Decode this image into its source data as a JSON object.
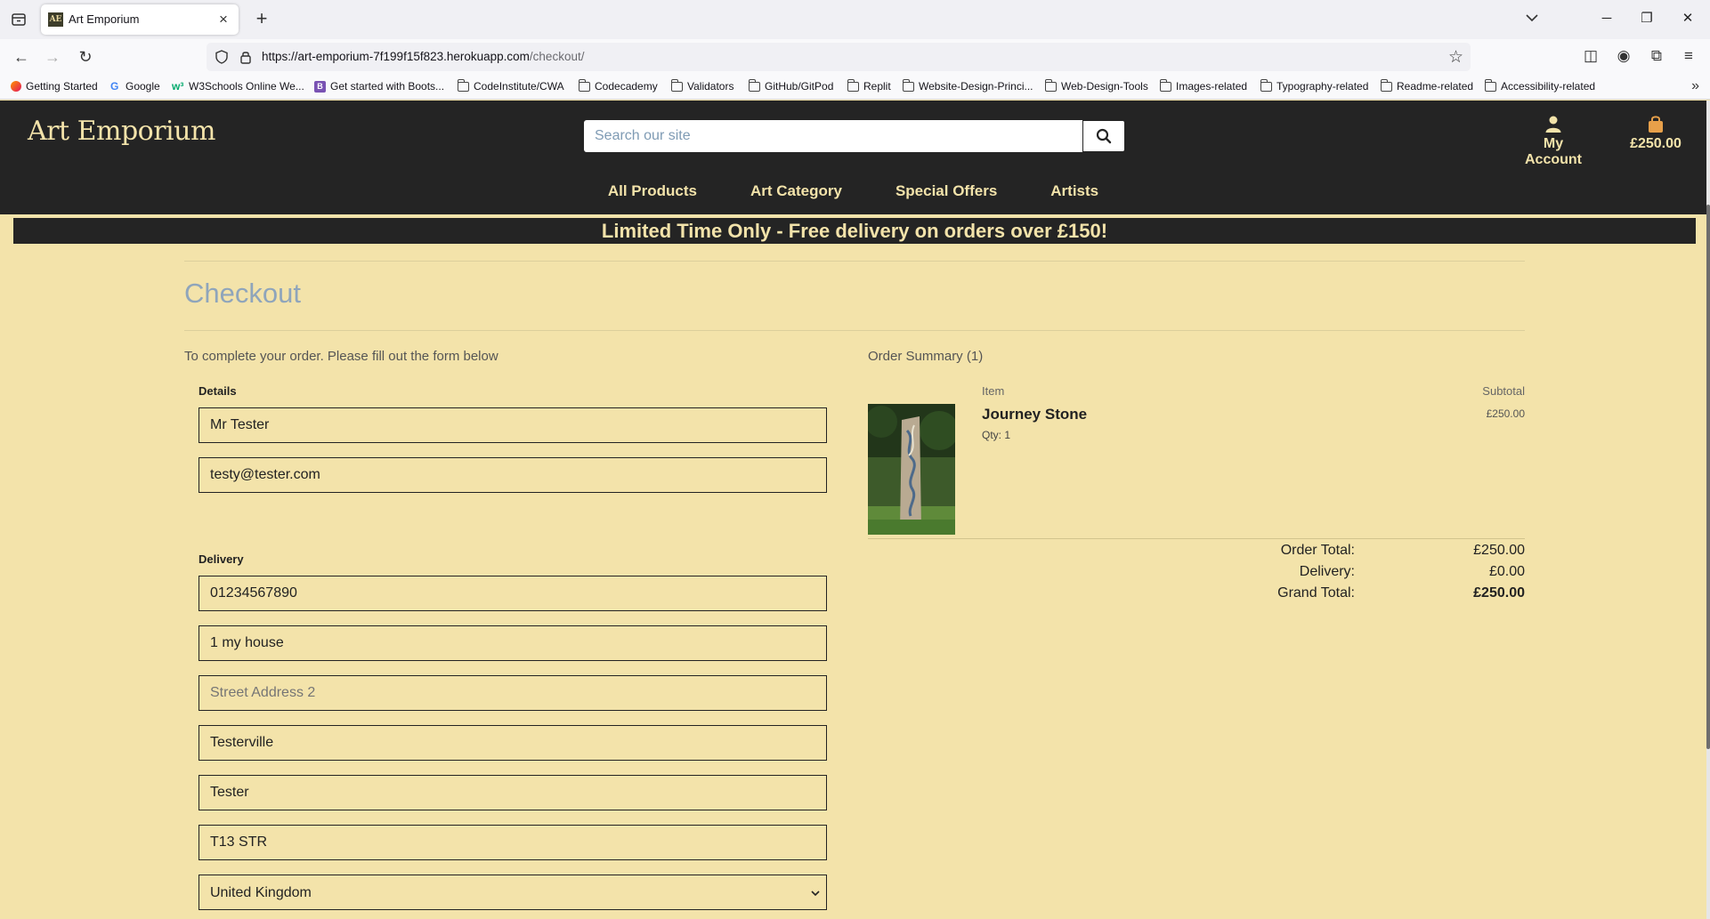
{
  "browser": {
    "tab_title": "Art Emporium",
    "tab_favicon_text": "AE",
    "url_host": "https://art-emporium-7f199f15f823.herokuapp.com",
    "url_path": "/checkout/",
    "bookmarks": [
      "Getting Started",
      "Google",
      "W3Schools Online We...",
      "Get started with Boots...",
      "CodeInstitute/CWA",
      "Codecademy",
      "Validators",
      "GitHub/GitPod",
      "Replit",
      "Website-Design-Princi...",
      "Web-Design-Tools",
      "Images-related",
      "Typography-related",
      "Readme-related",
      "Accessibility-related"
    ]
  },
  "header": {
    "logo": "Art Emporium",
    "search_placeholder": "Search our site",
    "account_label": "My Account",
    "cart_total": "£250.00",
    "nav": [
      "All Products",
      "Art Category",
      "Special Offers",
      "Artists"
    ]
  },
  "banner": "Limited Time Only - Free delivery on orders over £150!",
  "checkout": {
    "title": "Checkout",
    "lead": "To complete your order. Please fill out the form below",
    "details_label": "Details",
    "details": {
      "full_name": "Mr Tester",
      "email": "testy@tester.com"
    },
    "delivery_label": "Delivery",
    "delivery": {
      "phone": "01234567890",
      "street1": "1 my house",
      "street2_placeholder": "Street Address 2",
      "town": "Testerville",
      "county": "Tester",
      "postcode": "T13 STR",
      "country": "United Kingdom"
    }
  },
  "summary": {
    "title": "Order Summary (1)",
    "col_item": "Item",
    "col_subtotal": "Subtotal",
    "item": {
      "name": "Journey Stone",
      "qty": "Qty: 1",
      "subtotal": "£250.00"
    },
    "order_total_label": "Order Total:",
    "order_total": "£250.00",
    "delivery_label": "Delivery:",
    "delivery": "£0.00",
    "grand_total_label": "Grand Total:",
    "grand_total": "£250.00"
  }
}
